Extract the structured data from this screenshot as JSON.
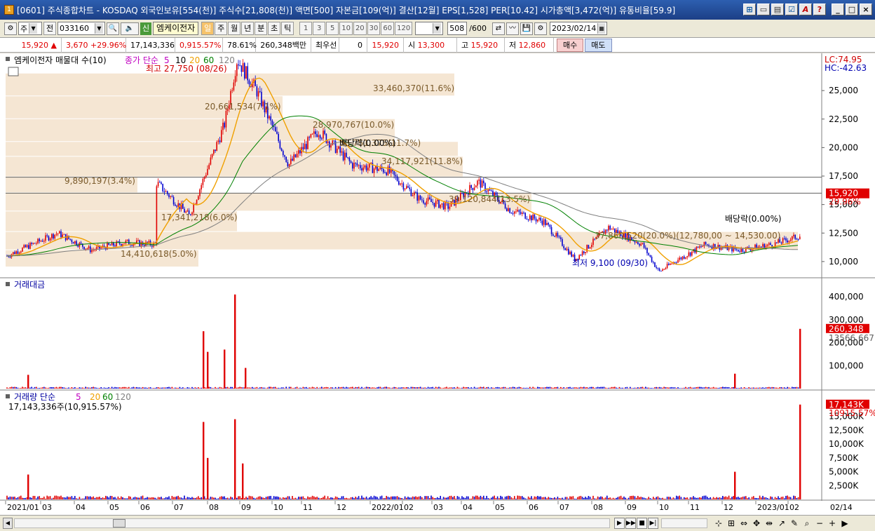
{
  "window": {
    "title": "[0601] 주식종합차트 - KOSDAQ 외국인보유[554(천)] 주식수[21,808(천)] 액면[500] 자본금[109(억)] 결산[12월] EPS[1,528] PER[10.42] 시가총액[3,472(억)] 유통비율[59.9]",
    "app_icon": "1"
  },
  "toolbar": {
    "type_label": "주",
    "all_label": "전",
    "code": "033160",
    "stock_name": "엠케이전자",
    "shin_label": "신",
    "periods": [
      "일",
      "주",
      "월",
      "년",
      "분",
      "초",
      "틱"
    ],
    "active_period": "일",
    "intervals": [
      "1",
      "3",
      "5",
      "10",
      "20",
      "30",
      "60",
      "120"
    ],
    "count": "508",
    "count_total": "/600",
    "date": "2023/02/14"
  },
  "quote": {
    "price": "15,920",
    "change": "3,670",
    "change_pct": "+29.96%",
    "volume": "17,143,336",
    "turnover": "0,915.57%",
    "ratio": "78.61%",
    "amount": "260,348백만",
    "priority_label": "최우선",
    "priority_value": "0",
    "ask": "15,920",
    "open_label": "시",
    "open": "13,300",
    "high_label": "고",
    "high": "15,920",
    "low_label": "저",
    "low": "12,860",
    "buy_label": "매수",
    "sell_label": "매도"
  },
  "price_panel": {
    "title": "엠케이전자 매물대 수(10)",
    "ma_label": "종가 단순",
    "ma_periods": [
      "5",
      "10",
      "20",
      "60",
      "120"
    ],
    "ma_colors": [
      "#c000c0",
      "#000000",
      "#f0a000",
      "#008000",
      "#808080"
    ],
    "lc": "LC:74.95",
    "hc": "HC:-42.63",
    "last_price_tag": "15,920",
    "last_pct_tag": "29.96%",
    "high_annotation": "최고 27,750 (08/26)",
    "low_annotation": "최저 9,100 (09/30)",
    "dividend_labels": [
      "배당락(0.00%)",
      "배당락(0.00%)"
    ],
    "volume_profile": [
      {
        "label": "33,460,370(11.6%)",
        "price_low": 24500,
        "price_high": 26500,
        "width": 640
      },
      {
        "label": "20,661,534(7.1%)",
        "price_low": 22500,
        "price_high": 24500,
        "width": 395
      },
      {
        "label": "28,970,767(10.0%)",
        "price_low": 20500,
        "price_high": 22500,
        "width": 555
      },
      {
        "label": "33,751,375(11.7%)",
        "price_low": 19200,
        "price_high": 20500,
        "width": 645
      },
      {
        "label": "34,117,921(11.8%)",
        "price_low": 17400,
        "price_high": 19200,
        "width": 652
      },
      {
        "label": "9,890,197(3.4%)",
        "price_low": 16000,
        "price_high": 17400,
        "width": 188
      },
      {
        "label": "39,120,844(13.5%)",
        "price_low": 14400,
        "price_high": 16000,
        "width": 750
      },
      {
        "label": "17,341,218(6.0%)",
        "price_low": 12600,
        "price_high": 14400,
        "width": 330
      },
      {
        "label": "37,860,520(20.0%)(12,780,00 ~ 14,530.00)",
        "price_low": 11000,
        "price_high": 12600,
        "width": 1130
      },
      {
        "label": "14,410,618(5.0%)",
        "price_low": 9500,
        "price_high": 11000,
        "width": 275
      }
    ],
    "y_ticks": [
      "25,000",
      "22,500",
      "20,000",
      "17,500",
      "15,000",
      "12,500",
      "10,000"
    ]
  },
  "amount_panel": {
    "title": "거래대금",
    "last_tag": "260,348",
    "ma_tag": "13566.667",
    "y_ticks": [
      "400,000",
      "300,000",
      "200,000",
      "100,000"
    ]
  },
  "volume_panel": {
    "title": "거래량 단순",
    "ma_periods": [
      "5",
      "20",
      "60",
      "120"
    ],
    "ma_colors": [
      "#c000c0",
      "#f0a000",
      "#008000",
      "#808080"
    ],
    "subtitle": "17,143,336주(10,915.57%)",
    "last_tag": "17,143K",
    "ma_tag": "10915.57%",
    "y_ticks": [
      "15,000K",
      "12,500K",
      "10,000K",
      "7,500K",
      "5,000K",
      "2,500K"
    ]
  },
  "x_axis": {
    "labels": [
      "2021/01",
      "03",
      "04",
      "05",
      "06",
      "07",
      "08",
      "09",
      "10",
      "11",
      "12",
      "2022/01",
      "02",
      "03",
      "04",
      "05",
      "06",
      "07",
      "08",
      "09",
      "10",
      "11",
      "12",
      "2023/01",
      "02"
    ],
    "right_label": "02/14"
  },
  "colors": {
    "up": "#e00000",
    "down": "#0000d0",
    "profile": "#f5e6d3",
    "title_bar": "#2d5fb0"
  },
  "chart_data": {
    "type": "candlestick",
    "ticker": "033160",
    "name": "엠케이전자",
    "period": "daily",
    "price_range": [
      8700,
      27900
    ],
    "key_points": [
      {
        "date": "2021/01",
        "price": 10500
      },
      {
        "date": "2021/03",
        "price": 12500
      },
      {
        "date": "2021/04",
        "price": 11000
      },
      {
        "date": "2021/05",
        "price": 11700
      },
      {
        "date": "2021/06",
        "price": 11500
      },
      {
        "date": "2021/06",
        "price": 17000
      },
      {
        "date": "2021/07",
        "price": 14000
      },
      {
        "date": "2021/08",
        "price": 22000
      },
      {
        "date": "2021/08/26",
        "price": 27750
      },
      {
        "date": "2021/09",
        "price": 25000
      },
      {
        "date": "2021/10",
        "price": 18500
      },
      {
        "date": "2021/11",
        "price": 21500
      },
      {
        "date": "2021/12",
        "price": 18500
      },
      {
        "date": "2022/01",
        "price": 18000
      },
      {
        "date": "2022/02",
        "price": 15500
      },
      {
        "date": "2022/03",
        "price": 14800
      },
      {
        "date": "2022/04",
        "price": 17000
      },
      {
        "date": "2022/05",
        "price": 14500
      },
      {
        "date": "2022/06",
        "price": 13500
      },
      {
        "date": "2022/07",
        "price": 10200
      },
      {
        "date": "2022/08",
        "price": 13000
      },
      {
        "date": "2022/09",
        "price": 11500
      },
      {
        "date": "2022/09/30",
        "price": 9100
      },
      {
        "date": "2022/10",
        "price": 10000
      },
      {
        "date": "2022/11",
        "price": 11500
      },
      {
        "date": "2022/12",
        "price": 11000
      },
      {
        "date": "2023/01",
        "price": 11500
      },
      {
        "date": "2023/02",
        "price": 12400
      },
      {
        "date": "2023/02/14",
        "price": 15920
      }
    ],
    "amount_spikes": [
      {
        "date": "2021/01",
        "value": 60000
      },
      {
        "date": "2021/08",
        "value": 250000
      },
      {
        "date": "2021/08",
        "value": 160000
      },
      {
        "date": "2021/08",
        "value": 170000
      },
      {
        "date": "2021/08",
        "value": 410000
      },
      {
        "date": "2021/09",
        "value": 90000
      },
      {
        "date": "2022/12",
        "value": 65000
      },
      {
        "date": "2023/02/14",
        "value": 260348
      }
    ],
    "volume_spikes": [
      {
        "date": "2021/01",
        "value": 4500
      },
      {
        "date": "2021/08",
        "value": 14000
      },
      {
        "date": "2021/08",
        "value": 7500
      },
      {
        "date": "2021/08",
        "value": 14500
      },
      {
        "date": "2021/09",
        "value": 6500
      },
      {
        "date": "2022/12",
        "value": 5000
      },
      {
        "date": "2023/02/14",
        "value": 17143
      }
    ]
  }
}
